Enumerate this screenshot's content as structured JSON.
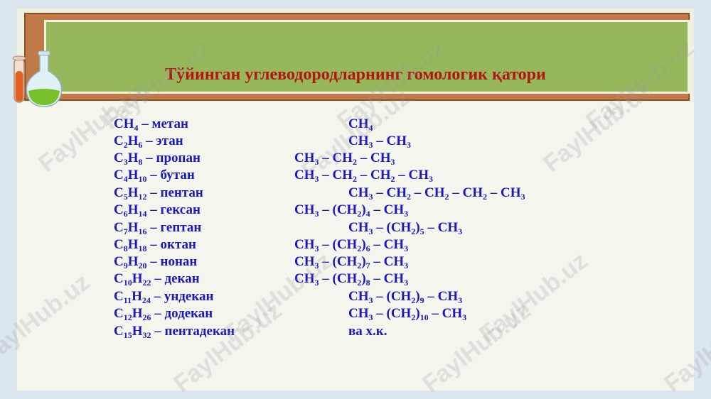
{
  "title": "Тўйинган углеводородларнинг гомологик қатори",
  "watermark": "FaylHub.uz",
  "rows": [
    {
      "left": [
        {
          "t": "CH"
        },
        {
          "s": "4"
        },
        {
          "t": " – метан"
        }
      ],
      "right": [
        {
          "t": "CH"
        },
        {
          "s": "4"
        }
      ]
    },
    {
      "left": [
        {
          "t": "C"
        },
        {
          "s": "2"
        },
        {
          "t": "H"
        },
        {
          "s": "6"
        },
        {
          "t": " – этан"
        }
      ],
      "right": [
        {
          "t": "CH"
        },
        {
          "s": "3"
        },
        {
          "t": " – CH"
        },
        {
          "s": "3"
        }
      ]
    },
    {
      "left": [
        {
          "t": "C"
        },
        {
          "s": "3"
        },
        {
          "t": "H"
        },
        {
          "s": "8"
        },
        {
          "t": " – пропан"
        }
      ],
      "right": [
        {
          "t": "CH"
        },
        {
          "s": "3"
        },
        {
          "t": " – CH"
        },
        {
          "s": "2"
        },
        {
          "t": " – CH"
        },
        {
          "s": "3"
        }
      ]
    },
    {
      "left": [
        {
          "t": "C"
        },
        {
          "s": "4"
        },
        {
          "t": "H"
        },
        {
          "s": "10"
        },
        {
          "t": " – бутан"
        }
      ],
      "right": [
        {
          "t": "CH"
        },
        {
          "s": "3"
        },
        {
          "t": " – CH"
        },
        {
          "s": "2"
        },
        {
          "t": " – CH"
        },
        {
          "s": "2"
        },
        {
          "t": " – CH"
        },
        {
          "s": "3"
        }
      ]
    },
    {
      "left": [
        {
          "t": "C"
        },
        {
          "s": "5"
        },
        {
          "t": "H"
        },
        {
          "s": "12"
        },
        {
          "t": " – пентан"
        }
      ],
      "right": [
        {
          "t": "CH"
        },
        {
          "s": "3"
        },
        {
          "t": " – CH"
        },
        {
          "s": "2"
        },
        {
          "t": " – CH"
        },
        {
          "s": "2"
        },
        {
          "t": " – CH"
        },
        {
          "s": "2"
        },
        {
          "t": " – CH"
        },
        {
          "s": "3"
        }
      ]
    },
    {
      "left": [
        {
          "t": "C"
        },
        {
          "s": "6"
        },
        {
          "t": "H"
        },
        {
          "s": "14"
        },
        {
          "t": " – гексан"
        }
      ],
      "right": [
        {
          "t": "CH"
        },
        {
          "s": "3"
        },
        {
          "t": " – (CH"
        },
        {
          "s": "2"
        },
        {
          "t": ")"
        },
        {
          "s": "4"
        },
        {
          "t": " – CH"
        },
        {
          "s": "3"
        }
      ]
    },
    {
      "left": [
        {
          "t": "C"
        },
        {
          "s": "7"
        },
        {
          "t": "H"
        },
        {
          "s": "16"
        },
        {
          "t": " – гептан"
        }
      ],
      "right": [
        {
          "t": "CH"
        },
        {
          "s": "3"
        },
        {
          "t": " – (CH"
        },
        {
          "s": "2"
        },
        {
          "t": ")"
        },
        {
          "s": "5"
        },
        {
          "t": " – CH"
        },
        {
          "s": "3"
        }
      ]
    },
    {
      "left": [
        {
          "t": "C"
        },
        {
          "s": "8"
        },
        {
          "t": "H"
        },
        {
          "s": "18"
        },
        {
          "t": " – октан"
        }
      ],
      "right": [
        {
          "t": "CH"
        },
        {
          "s": "3"
        },
        {
          "t": " – (CH"
        },
        {
          "s": "2"
        },
        {
          "t": ")"
        },
        {
          "s": "6"
        },
        {
          "t": " – CH"
        },
        {
          "s": "3"
        }
      ]
    },
    {
      "left": [
        {
          "t": "C"
        },
        {
          "s": "9"
        },
        {
          "t": "H"
        },
        {
          "s": "20"
        },
        {
          "t": " – нонан"
        }
      ],
      "right": [
        {
          "t": "CH"
        },
        {
          "s": "3"
        },
        {
          "t": " – (CH"
        },
        {
          "s": "2"
        },
        {
          "t": ")"
        },
        {
          "s": "7"
        },
        {
          "t": " – CH"
        },
        {
          "s": "3"
        }
      ]
    },
    {
      "left": [
        {
          "t": "C"
        },
        {
          "s": "10"
        },
        {
          "t": "H"
        },
        {
          "s": "22"
        },
        {
          "t": " – декан"
        }
      ],
      "right": [
        {
          "t": "CH"
        },
        {
          "s": "3"
        },
        {
          "t": " – (CH"
        },
        {
          "s": "2"
        },
        {
          "t": ")"
        },
        {
          "s": "8"
        },
        {
          "t": " – CH"
        },
        {
          "s": "3"
        }
      ]
    },
    {
      "left": [
        {
          "t": "C"
        },
        {
          "s": "11"
        },
        {
          "t": "H"
        },
        {
          "s": "24"
        },
        {
          "t": " – ундекан"
        }
      ],
      "right": [
        {
          "t": "CH"
        },
        {
          "s": "3"
        },
        {
          "t": " – (CH"
        },
        {
          "s": "2"
        },
        {
          "t": ")"
        },
        {
          "s": "9"
        },
        {
          "t": " – CH"
        },
        {
          "s": "3"
        }
      ]
    },
    {
      "left": [
        {
          "t": "C"
        },
        {
          "s": "12"
        },
        {
          "t": "H"
        },
        {
          "s": "26"
        },
        {
          "t": " – додекан"
        }
      ],
      "right": [
        {
          "t": "CH"
        },
        {
          "s": "3"
        },
        {
          "t": " – (CH"
        },
        {
          "s": "2"
        },
        {
          "t": ")"
        },
        {
          "s": "10"
        },
        {
          "t": " – CH"
        },
        {
          "s": "3"
        }
      ]
    },
    {
      "left": [
        {
          "t": "C"
        },
        {
          "s": "15"
        },
        {
          "t": "H"
        },
        {
          "s": "32"
        },
        {
          "t": " – пентадекан"
        }
      ],
      "right": [
        {
          "t": "ва х.к."
        }
      ]
    }
  ]
}
